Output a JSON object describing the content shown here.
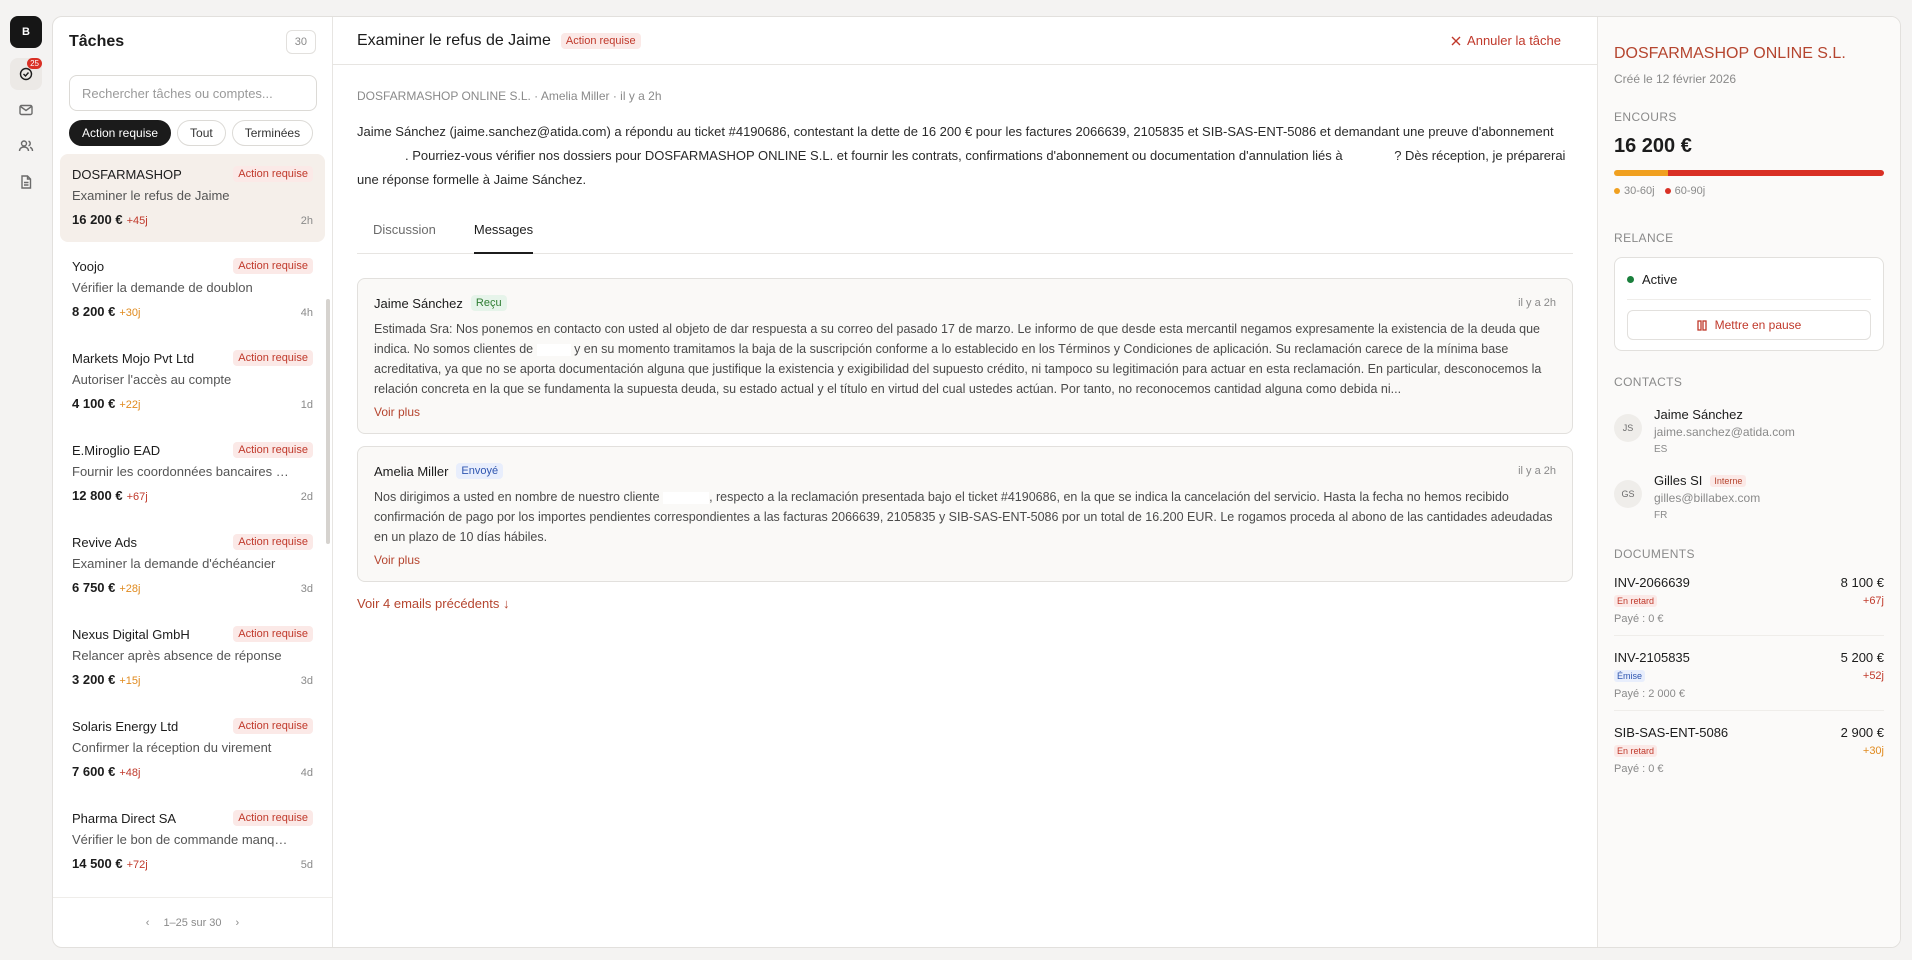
{
  "rail": {
    "logo": "B",
    "tasks_badge": "25"
  },
  "tasks": {
    "title": "Tâches",
    "count": "30",
    "search_placeholder": "Rechercher tâches ou comptes...",
    "filters": [
      "Action requise",
      "Tout",
      "Terminées"
    ],
    "items": [
      {
        "name": "DOSFARMASHOP",
        "badge": "Action requise",
        "desc": "Examiner le refus de Jaime",
        "amount": "16 200 €",
        "late": "+45j",
        "late_color": "#c0392b",
        "age": "2h"
      },
      {
        "name": "Yoojo",
        "badge": "Action requise",
        "desc": "Vérifier la demande de doublon",
        "amount": "8 200 €",
        "late": "+30j",
        "late_color": "#e08a1e",
        "age": "4h"
      },
      {
        "name": "Markets Mojo Pvt Ltd",
        "badge": "Action requise",
        "desc": "Autoriser l'accès au compte",
        "amount": "4 100 €",
        "late": "+22j",
        "late_color": "#e08a1e",
        "age": "1d"
      },
      {
        "name": "E.Miroglio EAD",
        "badge": "Action requise",
        "desc": "Fournir les coordonnées bancaires à jour",
        "amount": "12 800 €",
        "late": "+67j",
        "late_color": "#c0392b",
        "age": "2d"
      },
      {
        "name": "Revive Ads",
        "badge": "Action requise",
        "desc": "Examiner la demande d'échéancier",
        "amount": "6 750 €",
        "late": "+28j",
        "late_color": "#e08a1e",
        "age": "3d"
      },
      {
        "name": "Nexus Digital GmbH",
        "badge": "Action requise",
        "desc": "Relancer après absence de réponse",
        "amount": "3 200 €",
        "late": "+15j",
        "late_color": "#e08a1e",
        "age": "3d"
      },
      {
        "name": "Solaris Energy Ltd",
        "badge": "Action requise",
        "desc": "Confirmer la réception du virement",
        "amount": "7 600 €",
        "late": "+48j",
        "late_color": "#c0392b",
        "age": "4d"
      },
      {
        "name": "Pharma Direct SA",
        "badge": "Action requise",
        "desc": "Vérifier le bon de commande manquant",
        "amount": "14 500 €",
        "late": "+72j",
        "late_color": "#c0392b",
        "age": "5d"
      }
    ],
    "pager": {
      "prev": "‹",
      "label": "1–25 sur 30",
      "next": "›"
    }
  },
  "main": {
    "title": "Examiner le refus de Jaime",
    "badge": "Action requise",
    "cancel_label": "Annuler la tâche",
    "meta": "DOSFARMASHOP ONLINE S.L. · Amelia Miller · il y a 2h",
    "summary_a": "Jaime Sánchez (jaime.sanchez@atida.com) a répondu au ticket #4190686, contestant la dette de 16 200 € pour les factures 2066639, 2105835 et SIB-SAS-ENT-5086 et demandant une preuve d'abonnement",
    "summary_b": ". Pourriez-vous vérifier nos dossiers pour DOSFARMASHOP ONLINE S.L. et fournir les contrats, confirmations d'abonnement ou documentation d'annulation liés à",
    "summary_c": "? Dès réception, je préparerai une réponse formelle à Jaime Sánchez.",
    "tabs": [
      "Discussion",
      "Messages"
    ],
    "messages": [
      {
        "from": "Jaime Sánchez",
        "tag": "Reçu",
        "time": "il y a 2h",
        "body_a": "Estimada Sra: Nos ponemos en contacto con usted al objeto de dar respuesta a su correo del pasado 17 de marzo. Le informo de que desde esta mercantil negamos expresamente la existencia de la deuda que indica. No somos clientes de",
        "body_b": "y en su momento tramitamos la baja de la suscripción conforme a lo establecido en los Términos y Condiciones de aplicación. Su reclamación carece de la mínima base acreditativa, ya que no se aporta documentación alguna que justifique la existencia y exigibilidad del supuesto crédito, ni tampoco su legitimación para actuar en esta reclamación. En particular, desconocemos la relación concreta en la que se fundamenta la supuesta deuda, su estado actual y el título en virtud del cual ustedes actúan. Por tanto, no reconocemos cantidad alguna como debida ni...",
        "more": "Voir plus"
      },
      {
        "from": "Amelia Miller",
        "tag": "Envoyé",
        "time": "il y a 2h",
        "body_a": "Nos dirigimos a usted en nombre de nuestro cliente",
        "body_b": ", respecto a la reclamación presentada bajo el ticket #4190686, en la que se indica la cancelación del servicio. Hasta la fecha no hemos recibido confirmación de pago por los importes pendientes correspondientes a las facturas 2066639, 2105835 y SIB-SAS-ENT-5086 por un total de 16.200 EUR. Le rogamos proceda al abono de las cantidades adeudadas en un plazo de 10 días hábiles.",
        "more": "Voir plus"
      }
    ],
    "previous_link": "Voir 4 emails précédents ↓"
  },
  "side": {
    "company": "DOSFARMASHOP ONLINE S.L.",
    "created": "Créé le 12 février 2026",
    "encours_label": "Encours",
    "encours_amount": "16 200 €",
    "aging": [
      {
        "label": "30-60j",
        "share": 0.2,
        "color": "#f0a020"
      },
      {
        "label": "60-90j",
        "share": 0.8,
        "color": "#d93025"
      }
    ],
    "relance_label": "Relance",
    "relance_status": "Active",
    "pause_label": "Mettre en pause",
    "contacts_label": "Contacts",
    "contacts": [
      {
        "initials": "JS",
        "name": "Jaime Sánchez",
        "tag": "",
        "email": "jaime.sanchez@atida.com",
        "lang": "ES"
      },
      {
        "initials": "GS",
        "name": "Gilles SI",
        "tag": "Interne",
        "email": "gilles@billabex.com",
        "lang": "FR"
      }
    ],
    "documents_label": "Documents",
    "documents": [
      {
        "id": "INV-2066639",
        "amount": "8 100 €",
        "status": "En retard",
        "status_kind": "red",
        "late": "+67j",
        "late_color": "#c0392b",
        "paid": "Payé : 0 €"
      },
      {
        "id": "INV-2105835",
        "amount": "5 200 €",
        "status": "Émise",
        "status_kind": "blue",
        "late": "+52j",
        "late_color": "#c0392b",
        "paid": "Payé : 2 000 €"
      },
      {
        "id": "SIB-SAS-ENT-5086",
        "amount": "2 900 €",
        "status": "En retard",
        "status_kind": "red",
        "late": "+30j",
        "late_color": "#e08a1e",
        "paid": "Payé : 0 €"
      }
    ]
  }
}
